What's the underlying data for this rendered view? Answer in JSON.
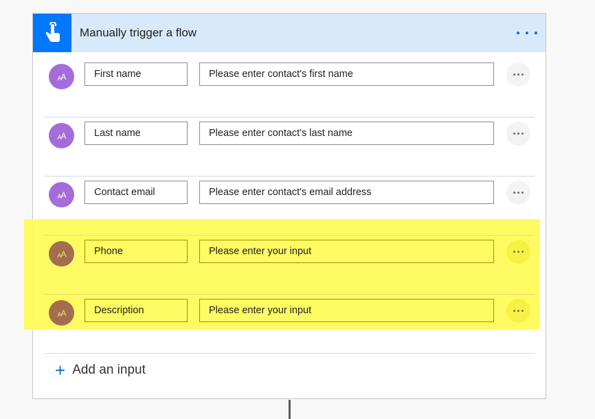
{
  "trigger": {
    "title": "Manually trigger a flow",
    "icon": "touch-hand-icon",
    "more_icon": "ellipsis-icon",
    "accent_color": "#0078fe",
    "header_bg_color": "#d8e9fc"
  },
  "inputs": [
    {
      "name": "First name",
      "description": "Please enter contact's first name",
      "avatar_text": "AA",
      "type_icon": "text-type-icon",
      "highlighted": false
    },
    {
      "name": "Last name",
      "description": "Please enter contact's last name",
      "avatar_text": "AA",
      "type_icon": "text-type-icon",
      "highlighted": false
    },
    {
      "name": "Contact email",
      "description": "Please enter contact's email address",
      "avatar_text": "AA",
      "type_icon": "text-type-icon",
      "highlighted": false
    },
    {
      "name": "Phone",
      "description": "Please enter your input",
      "avatar_text": "AA",
      "type_icon": "text-type-icon",
      "highlighted": true
    },
    {
      "name": "Description",
      "description": "Please enter your input",
      "avatar_text": "AA",
      "type_icon": "text-type-icon",
      "highlighted": true
    }
  ],
  "add_input": {
    "icon": "+",
    "label": "Add an input"
  },
  "colors": {
    "avatar_default": "#a46cdb",
    "avatar_highlighted": "#a26e4f",
    "highlight": "#fffb55"
  }
}
